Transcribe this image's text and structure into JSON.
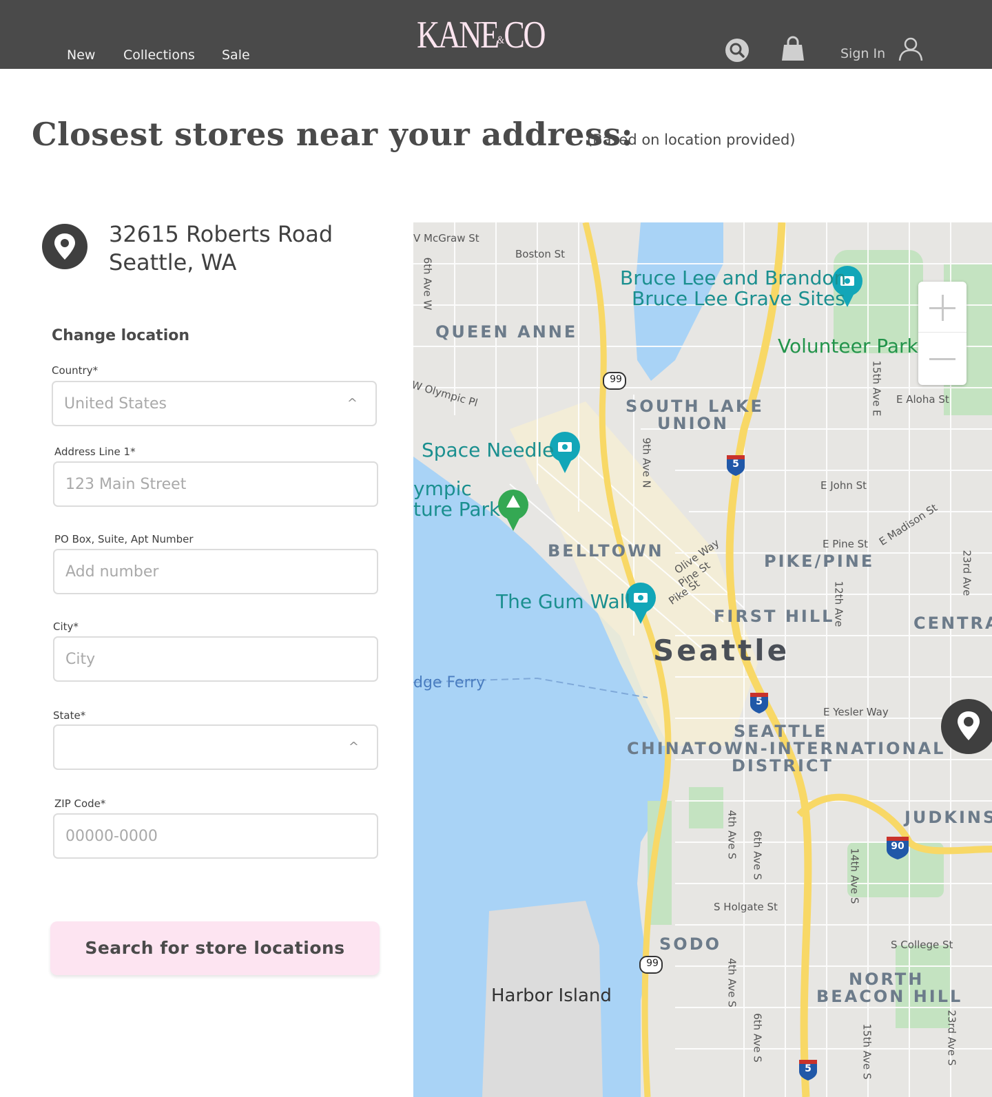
{
  "header": {
    "nav": [
      "New",
      "Collections",
      "Sale"
    ],
    "logo_left": "KANE",
    "logo_amp": "&",
    "logo_right": "CO",
    "sign_in": "Sign In",
    "icons": [
      "search-icon",
      "shopping-bag-icon",
      "user-icon"
    ]
  },
  "page": {
    "title": "Closest stores near your address:",
    "subtitle": "(Based on location provided)"
  },
  "address": {
    "line1": "32615 Roberts Road",
    "line2": "Seattle, WA"
  },
  "form": {
    "heading": "Change location",
    "country": {
      "label": "Country*",
      "value": "United States"
    },
    "address1": {
      "label": "Address Line 1*",
      "placeholder": "123 Main Street"
    },
    "address2": {
      "label": "PO Box, Suite, Apt Number",
      "placeholder": "Add number"
    },
    "city": {
      "label": "City*",
      "placeholder": "City"
    },
    "state": {
      "label": "State*",
      "value": ""
    },
    "zip": {
      "label": "ZIP Code*",
      "placeholder": "00000-0000"
    },
    "submit": "Search for store locations"
  },
  "map": {
    "labels": {
      "queen_anne": "QUEEN ANNE",
      "south_lake_union_1": "SOUTH LAKE",
      "south_lake_union_2": "UNION",
      "belltown": "BELLTOWN",
      "pike_pine": "PIKE/PINE",
      "first_hill": "FIRST HILL",
      "seattle": "Seattle",
      "chinatown_1": "SEATTLE",
      "chinatown_2": "CHINATOWN-INTERNATIONAL",
      "chinatown_3": "DISTRICT",
      "sodo": "SODO",
      "north_beacon_1": "NORTH",
      "north_beacon_2": "BEACON HILL",
      "judkins": "JUDKINS",
      "central": "CENTRA",
      "harbor_island": "Harbor Island",
      "bruce_lee_1": "Bruce Lee and Brandon",
      "bruce_lee_2": "Bruce Lee Grave Sites",
      "volunteer_park": "Volunteer Park",
      "space_needle": "Space Needle",
      "olympic_1": "ympic",
      "olympic_2": "ture Park",
      "gum_wall": "The Gum Wall",
      "ferry": "dge Ferry",
      "mcgraw": "V McGraw St",
      "boston": "Boston St",
      "sixth_w": "6th Ave W",
      "olympic_pl": "W Olympic Pl",
      "ninth_n": "9th Ave N",
      "fifteenth_e": "15th Ave E",
      "aloha": "E Aloha St",
      "john": "E John St",
      "pine_e": "E Pine St",
      "madison": "E Madison St",
      "olive": "Olive Way",
      "pine": "Pine St",
      "pike": "Pike St",
      "twelfth": "12th Ave",
      "twenty_third": "23rd Ave",
      "yesler": "E Yesler Way",
      "fourth_s": "4th Ave S",
      "sixth_s": "6th Ave S",
      "fourteenth_s": "14th Ave S",
      "holgate": "S Holgate St",
      "college": "S College St",
      "fifteenth_s": "15th Ave S",
      "twenty_third_s": "23rd Ave S",
      "hwy99": "99",
      "i5": "5",
      "i90": "90"
    }
  }
}
